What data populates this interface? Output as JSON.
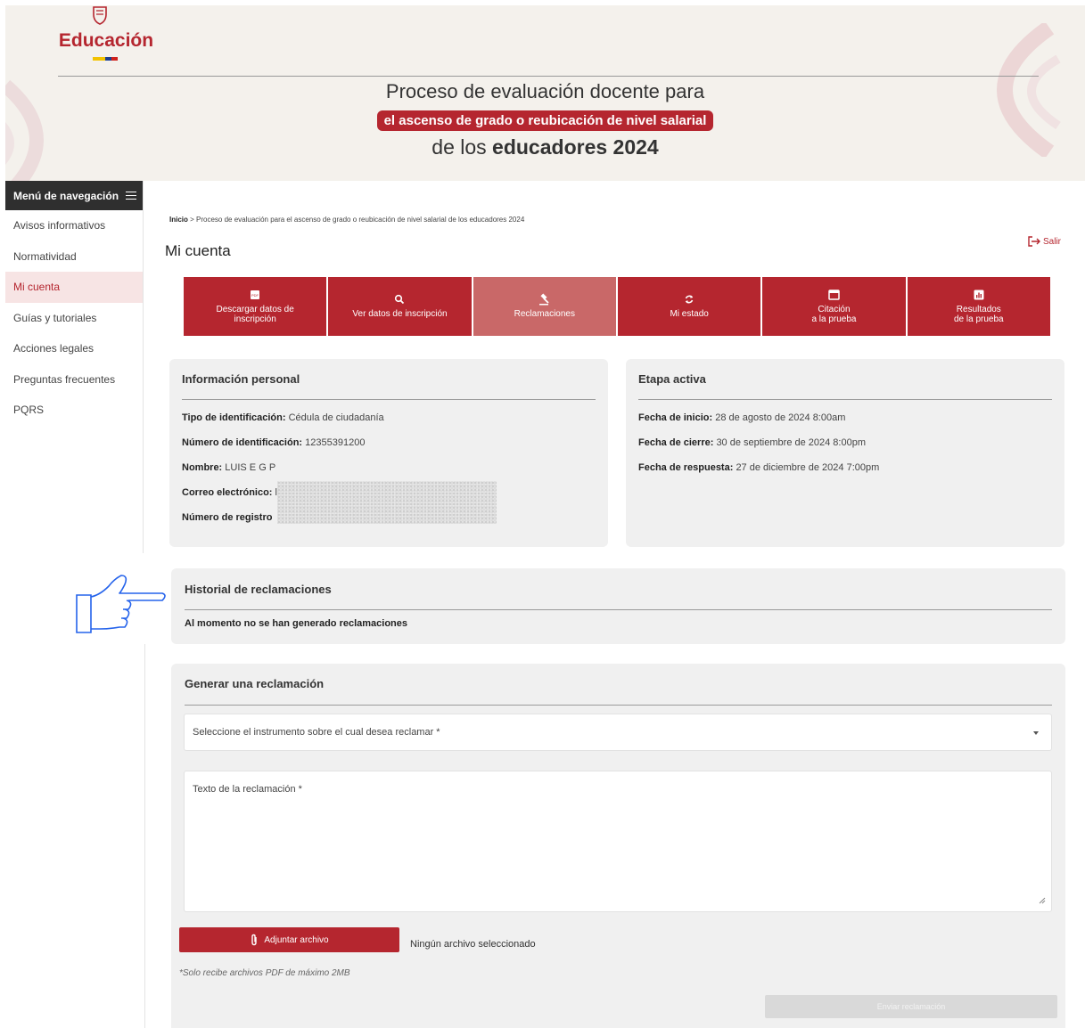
{
  "header": {
    "brand": "Educación",
    "title_line1": "Proceso de evaluación docente para",
    "title_highlight": "el ascenso de grado o reubicación de nivel salarial",
    "title_line3_prefix": "de los",
    "title_line3_bold": "educadores 2024",
    "colors": {
      "brand_red": "#b5262f",
      "flag_yellow": "#f2c200",
      "flag_blue": "#1d3f8f",
      "flag_red": "#d0211c"
    }
  },
  "sidebar": {
    "header_label": "Menú de navegación",
    "items": [
      {
        "label": "Avisos informativos",
        "active": false
      },
      {
        "label": "Normatividad",
        "active": false
      },
      {
        "label": "Mi cuenta",
        "active": true
      },
      {
        "label": "Guías y tutoriales",
        "active": false
      },
      {
        "label": "Acciones legales",
        "active": false
      },
      {
        "label": "Preguntas frecuentes",
        "active": false
      },
      {
        "label": "PQRS",
        "active": false
      }
    ]
  },
  "breadcrumb": {
    "home": "Inicio",
    "separator": ">",
    "current": "Proceso de evaluación para el ascenso de grado o reubicación de nivel salarial de los educadores 2024"
  },
  "page_title": "Mi cuenta",
  "logout_label": "Salir",
  "tabs": [
    {
      "icon": "pdf-icon",
      "line1": "Descargar datos de",
      "line2": "inscripción",
      "active": false
    },
    {
      "icon": "search-icon",
      "line1": "Ver datos de inscripción",
      "line2": "",
      "active": false
    },
    {
      "icon": "gavel-icon",
      "line1": "Reclamaciones",
      "line2": "",
      "active": true
    },
    {
      "icon": "refresh-icon",
      "line1": "Mi estado",
      "line2": "",
      "active": false
    },
    {
      "icon": "calendar-icon",
      "line1": "Citación",
      "line2": "a la prueba",
      "active": false
    },
    {
      "icon": "chart-icon",
      "line1": "Resultados",
      "line2": "de la prueba",
      "active": false
    }
  ],
  "personal_info": {
    "title": "Información personal",
    "fields": [
      {
        "label": "Tipo de identificación:",
        "value": "Cédula de ciudadanía"
      },
      {
        "label": "Número de identificación:",
        "value": "12355391200"
      },
      {
        "label": "Nombre:",
        "value": "LUIS E G P"
      },
      {
        "label": "Correo electrónico:",
        "value": "l"
      },
      {
        "label": "Número de registro",
        "value": ""
      }
    ]
  },
  "active_stage": {
    "title": "Etapa activa",
    "fields": [
      {
        "label": "Fecha de inicio:",
        "value": "28 de agosto de 2024 8:00am"
      },
      {
        "label": "Fecha de cierre:",
        "value": "30 de septiembre de 2024 8:00pm"
      },
      {
        "label": "Fecha de respuesta:",
        "value": "27 de diciembre de 2024 7:00pm"
      }
    ]
  },
  "claims_history": {
    "title": "Historial de reclamaciones",
    "empty_message": "Al momento no se han generado reclamaciones"
  },
  "new_claim": {
    "title": "Generar una reclamación",
    "instrument_placeholder": "Seleccione el instrumento sobre el cual desea reclamar *",
    "text_placeholder": "Texto de la reclamación *",
    "attach_label": "Adjuntar archivo",
    "no_file_label": "Ningún archivo seleccionado",
    "hint": "*Solo recibe archivos PDF de máximo 2MB",
    "submit_label": "Enviar reclamación"
  }
}
